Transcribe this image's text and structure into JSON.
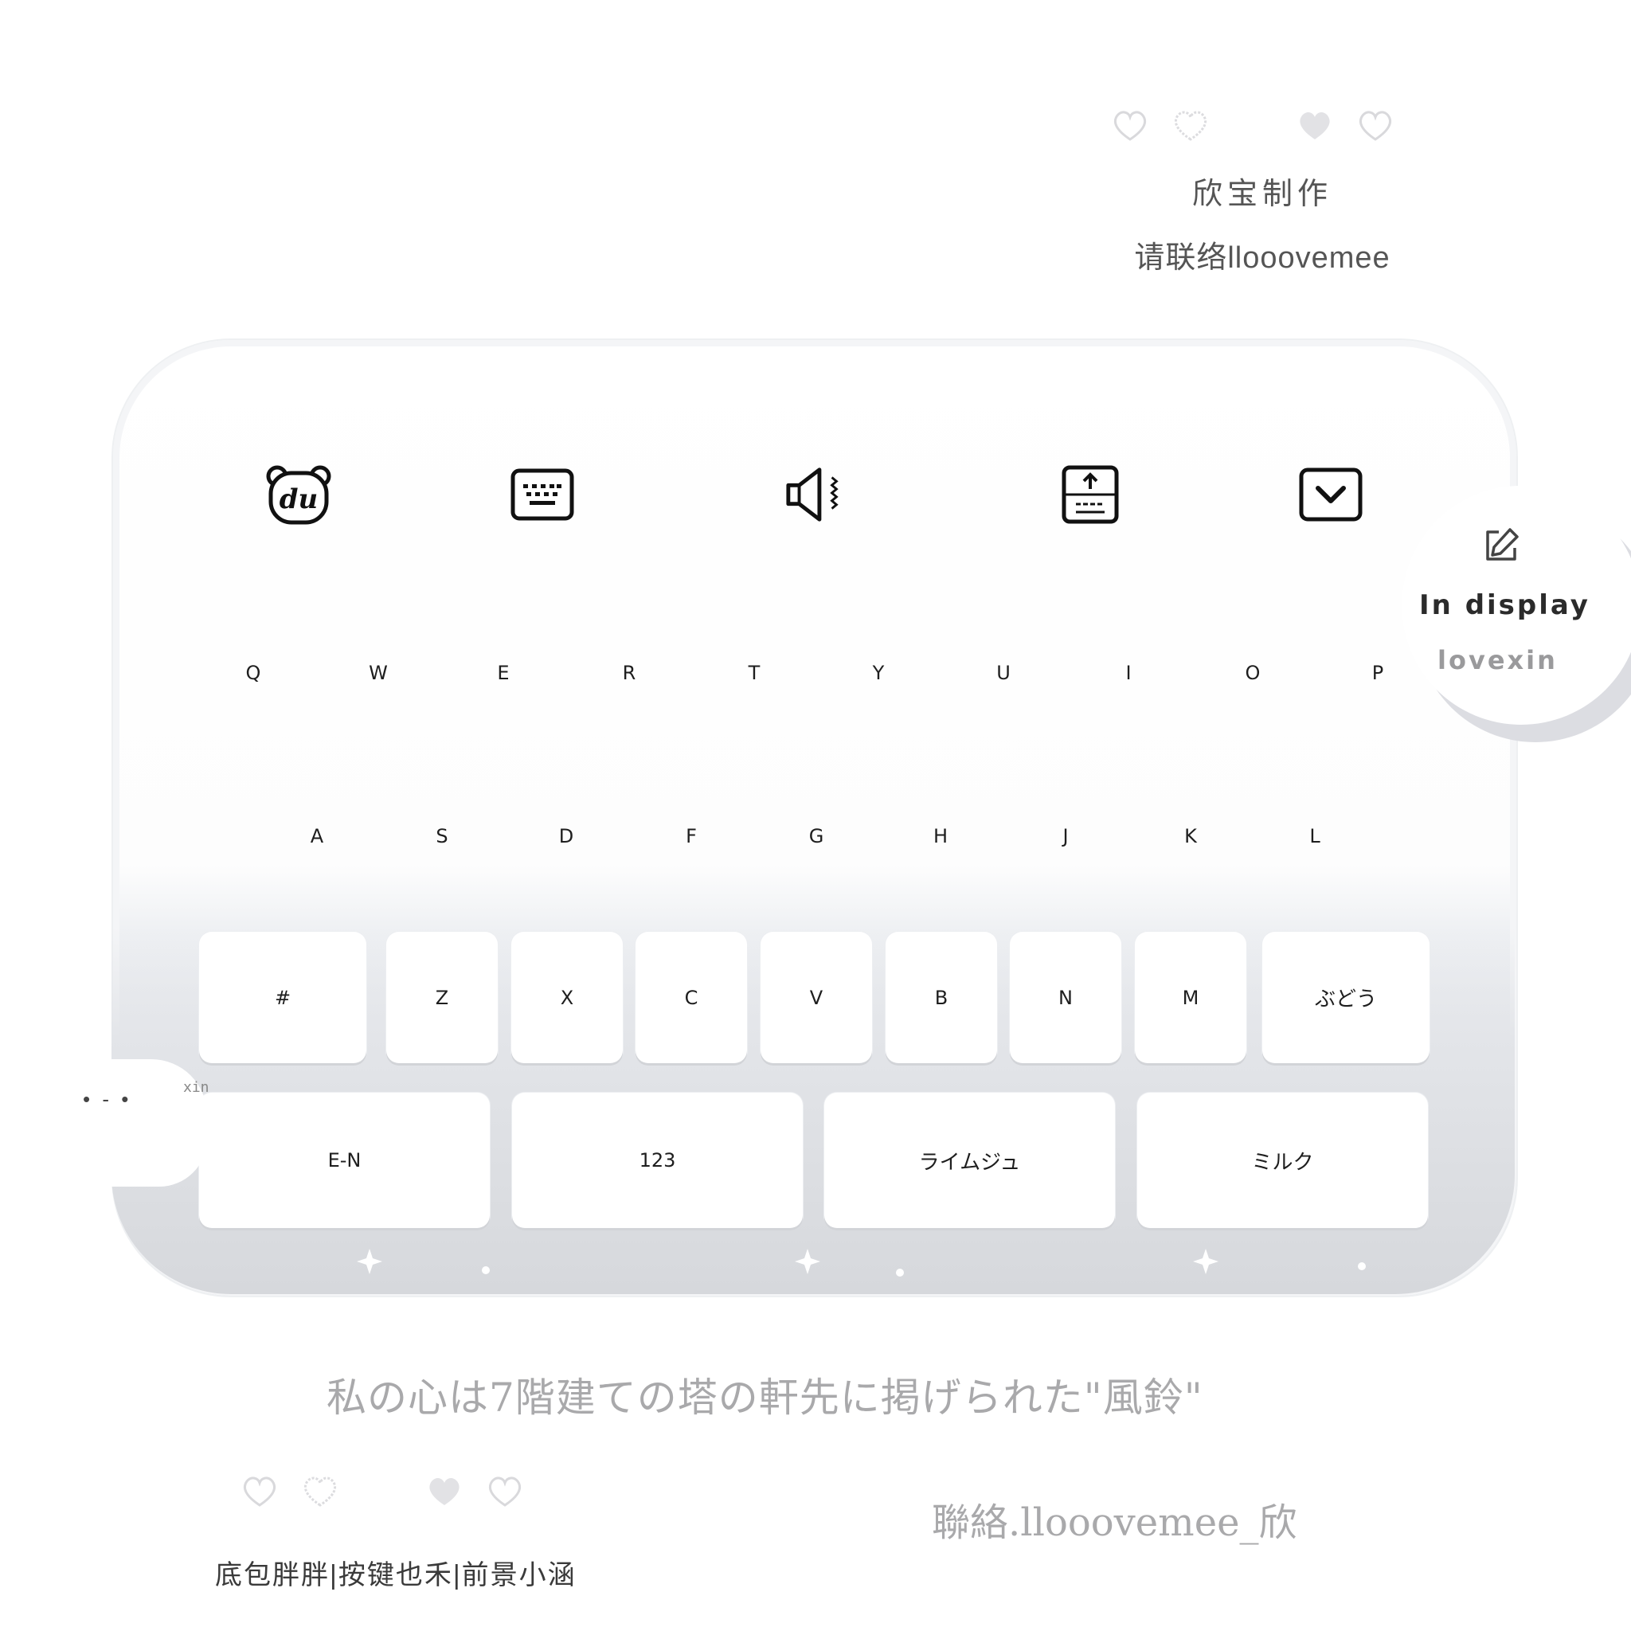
{
  "credit": {
    "maker": "欣宝制作",
    "contact": "请联络llooovemee"
  },
  "toolbar": {
    "items": [
      {
        "name": "du-bear-icon"
      },
      {
        "name": "keyboard-icon"
      },
      {
        "name": "speaker-icon"
      },
      {
        "name": "upload-panel-icon"
      },
      {
        "name": "collapse-chevron-icon"
      }
    ]
  },
  "side": {
    "label1": "In display",
    "label2": "lovexin"
  },
  "keyboard": {
    "row1": [
      "Q",
      "W",
      "E",
      "R",
      "T",
      "Y",
      "U",
      "I",
      "O",
      "P"
    ],
    "row2": [
      "A",
      "S",
      "D",
      "F",
      "G",
      "H",
      "J",
      "K",
      "L"
    ],
    "row3": [
      "#",
      "Z",
      "X",
      "C",
      "V",
      "B",
      "N",
      "M",
      "ぶどう"
    ],
    "row4": [
      "E-N",
      "123",
      "ライムジュ",
      "ミルク"
    ]
  },
  "decor": {
    "xin": "xin",
    "dots": "• - •"
  },
  "footer": {
    "quote": "私の心は7階建ての塔の軒先に掲げられた\"風鈴\"",
    "contact": "聯絡.llooovemee_欣",
    "credits": "底包胖胖|按键也禾|前景小涵"
  },
  "colors": {
    "panel": "#ffffff",
    "keyShadow": "#d2d4d8",
    "muted": "#a9a9ab"
  }
}
